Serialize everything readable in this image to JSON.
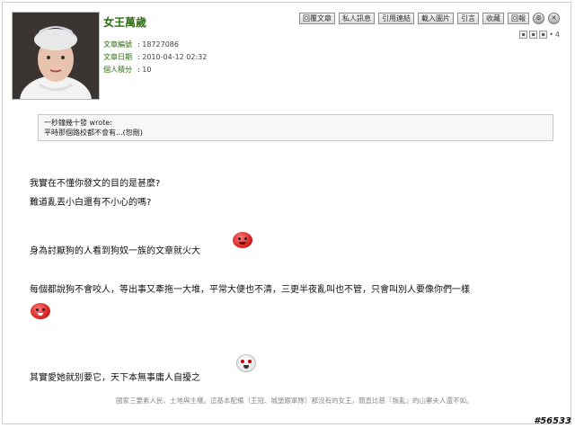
{
  "post": {
    "author": "女王萬歲",
    "meta": [
      {
        "label": "文章編號",
        "value": "18727086"
      },
      {
        "label": "文章日期",
        "value": "2010-04-12 02:32"
      },
      {
        "label": "個人積分",
        "value": "10"
      }
    ]
  },
  "toolbar": {
    "buttons": [
      "回覆文章",
      "私人訊息",
      "引用連結",
      "載入圖片",
      "引言",
      "收藏",
      "回報"
    ]
  },
  "pager": {
    "floor": "4"
  },
  "quote": {
    "by": "一秒鐘幾十發 wrote:",
    "text": "平時那個路校都不會有...(恕刪)"
  },
  "body": {
    "line1": "我實在不懂你發文的目的是甚麼?",
    "line2": "難道亂丟小白還有不小心的嗎?",
    "line3": "身為討厭狗的人看到狗奴一族的文章就火大",
    "line4": "每個都說狗不會咬人，等出事又牽拖一大堆，平常大便也不清，三更半夜亂叫也不管，只會叫別人要像你們一樣",
    "line5": "其實愛她就別要它，天下本無事庸人自擾之"
  },
  "signature": "國家三要素人民、土地與主權。這基本配備（王冠、城堡跟軍隊）都沒有的女王，簡直比慈『叛亂』的山寨夫人還不如。",
  "stamp": "#56533"
}
